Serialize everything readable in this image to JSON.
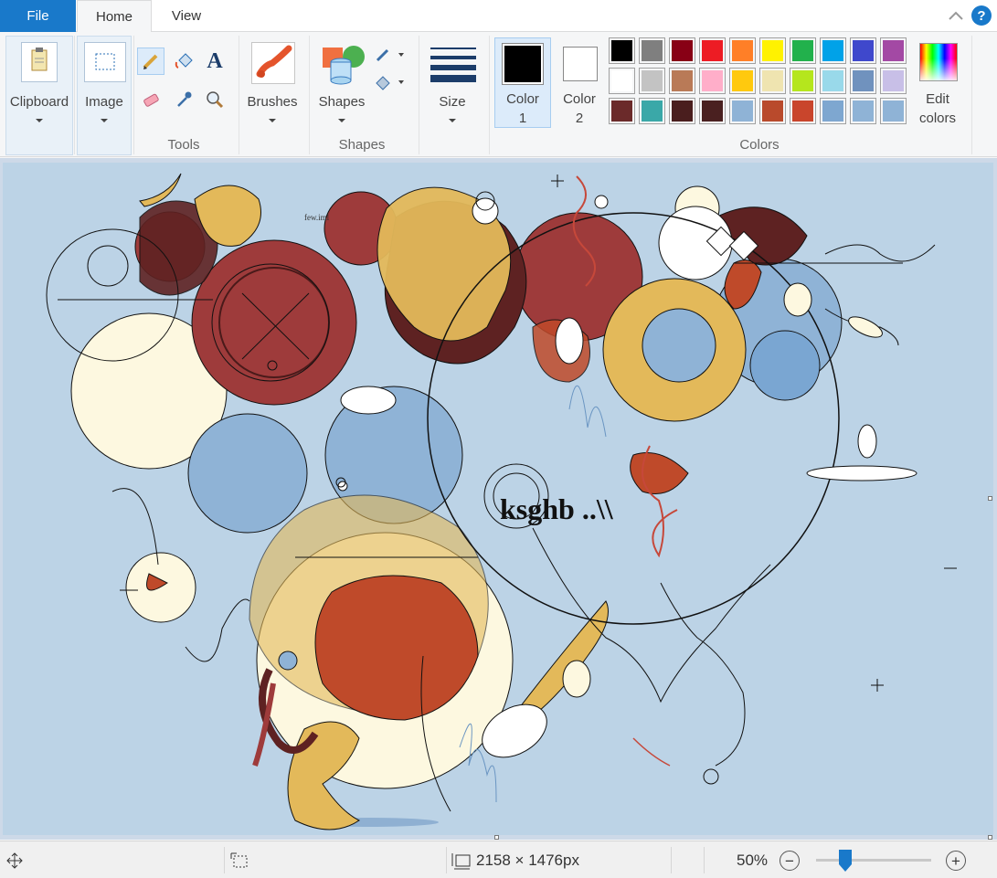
{
  "tabs": {
    "file": "File",
    "home": "Home",
    "view": "View",
    "help": "?"
  },
  "ribbon": {
    "clipboard": {
      "label": "Clipboard"
    },
    "image": {
      "label": "Image"
    },
    "tools": {
      "group_label": "Tools",
      "items": [
        "pencil-icon",
        "fill-icon",
        "text-icon",
        "eraser-icon",
        "color-picker-icon",
        "magnifier-icon"
      ],
      "text_glyph": "A"
    },
    "brushes": {
      "label": "Brushes"
    },
    "shapes": {
      "label": "Shapes",
      "group_label": "Shapes"
    },
    "size": {
      "label": "Size"
    },
    "color1": {
      "label": "Color",
      "sub": "1",
      "color": "#000000"
    },
    "color2": {
      "label": "Color",
      "sub": "2",
      "color": "#ffffff"
    },
    "colors": {
      "group_label": "Colors",
      "palette_row1": [
        "#000000",
        "#7f7f7f",
        "#880015",
        "#ed1c24",
        "#ff7f27",
        "#fff200",
        "#22b14c",
        "#00a2e8",
        "#3f48cc",
        "#a349a4"
      ],
      "palette_row2": [
        "#ffffff",
        "#c3c3c3",
        "#b97a57",
        "#ffaec9",
        "#ffc90e",
        "#efe4b0",
        "#b5e61d",
        "#99d9ea",
        "#7092be",
        "#c8bfe7"
      ],
      "palette_row3": [
        "#6b2a2a",
        "#3aa8a8",
        "#4a1e1e",
        "#4a2020",
        "#8fb3d6",
        "#b94a2c",
        "#c9452c",
        "#7ea7d0",
        "#8fb3d6",
        "#8fb3d6"
      ]
    },
    "edit_colors": {
      "line1": "Edit",
      "line2": "colors"
    }
  },
  "canvas": {
    "text": "ksghb ..\\\\",
    "small_text": "few.iml",
    "palette_art": {
      "maroon": "#9e3b3b",
      "dark": "#5e2222",
      "cream": "#fdf8e0",
      "gold": "#e3b95a",
      "blue": "#8fb3d6",
      "rust": "#bf4a2a",
      "bg": "#bcd3e6"
    }
  },
  "status": {
    "dimensions": "2158 × 1476px",
    "zoom": "50%",
    "zoom_level": 0.25
  }
}
